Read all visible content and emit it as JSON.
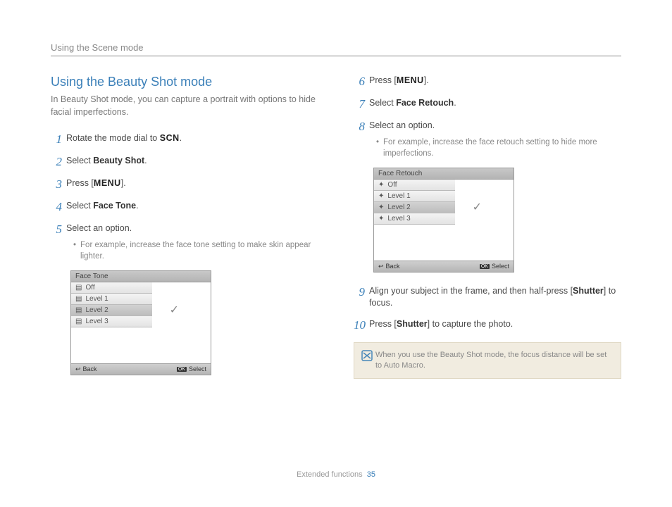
{
  "header": {
    "chapter": "Using the Scene mode"
  },
  "left": {
    "title": "Using the Beauty Shot mode",
    "intro": "In Beauty Shot mode, you can capture a portrait with options to hide facial imperfections.",
    "steps": {
      "s1": "Rotate the mode dial to ",
      "s1_scn": "SCN",
      "s1_end": ".",
      "s2_a": "Select ",
      "s2_b": "Beauty Shot",
      "s2_c": ".",
      "s3_a": "Press [",
      "s3_b": "MENU",
      "s3_c": "].",
      "s4_a": "Select ",
      "s4_b": "Face Tone",
      "s4_c": ".",
      "s5": "Select an option.",
      "s5_sub": "For example, increase the face tone setting to make skin appear lighter."
    },
    "ui": {
      "title": "Face Tone",
      "off": "Off",
      "l1": "Level 1",
      "l2": "Level 2",
      "l3": "Level 3",
      "back": "Back",
      "select": "Select"
    }
  },
  "right": {
    "steps": {
      "s6_a": "Press [",
      "s6_b": "MENU",
      "s6_c": "].",
      "s7_a": "Select ",
      "s7_b": "Face Retouch",
      "s7_c": ".",
      "s8": "Select an option.",
      "s8_sub": "For example, increase the face retouch setting to hide more imperfections.",
      "s9_a": "Align your subject in the frame, and then half-press [",
      "s9_b": "Shutter",
      "s9_c": "] to focus.",
      "s10_a": "Press [",
      "s10_b": "Shutter",
      "s10_c": "] to capture the photo."
    },
    "ui": {
      "title": "Face Retouch",
      "off": "Off",
      "l1": "Level 1",
      "l2": "Level 2",
      "l3": "Level 3",
      "back": "Back",
      "select": "Select"
    },
    "note": "When you use the Beauty Shot mode, the focus distance will be set to Auto Macro."
  },
  "footer": {
    "section": "Extended functions",
    "page": "35"
  }
}
